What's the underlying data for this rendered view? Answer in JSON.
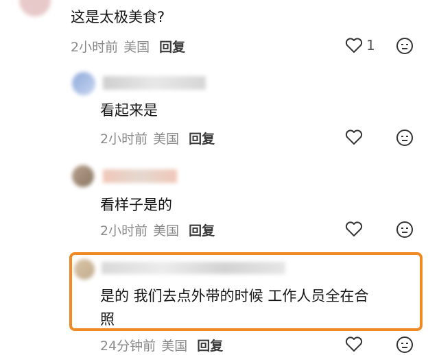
{
  "comments": [
    {
      "text": "这是太极美食?",
      "time": "2小时前",
      "location": "美国",
      "reply_label": "回复",
      "like_count": "1"
    },
    {
      "text": "看起来是",
      "time": "2小时前",
      "location": "美国",
      "reply_label": "回复"
    },
    {
      "text": "看样子是的",
      "time": "2小时前",
      "location": "美国",
      "reply_label": "回复"
    },
    {
      "text_line1": "是的 我们去点外带的时候 工作人员全在合",
      "text_line2": "照",
      "time": "24分钟前",
      "location": "美国",
      "reply_label": "回复"
    }
  ],
  "colors": {
    "highlight": "#f08a24",
    "meta": "#8a8a8a"
  },
  "icons": [
    "heart-icon",
    "expressionless-face-icon"
  ]
}
